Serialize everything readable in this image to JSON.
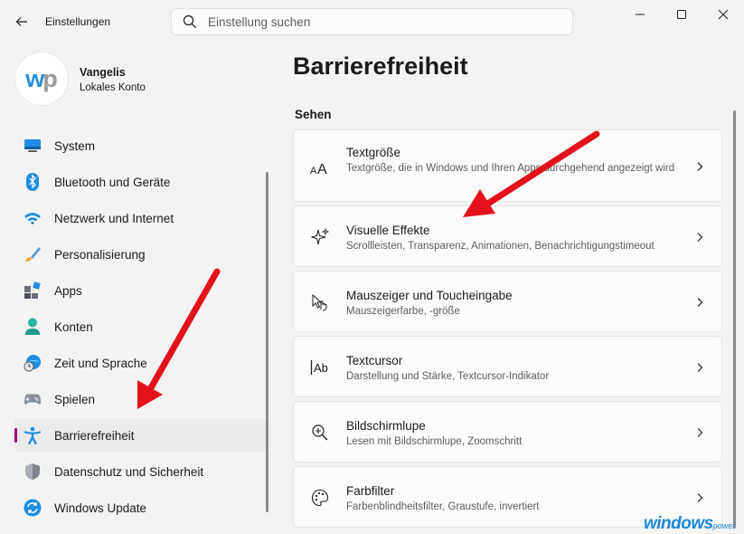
{
  "window": {
    "app_title": "Einstellungen",
    "search_placeholder": "Einstellung suchen"
  },
  "profile": {
    "avatar_text_1": "w",
    "avatar_text_2": "p",
    "name": "Vangelis",
    "account_type": "Lokales Konto"
  },
  "sidebar": {
    "items": [
      {
        "label": "System",
        "icon": "system-icon"
      },
      {
        "label": "Bluetooth und Geräte",
        "icon": "bluetooth-icon"
      },
      {
        "label": "Netzwerk und Internet",
        "icon": "wifi-icon"
      },
      {
        "label": "Personalisierung",
        "icon": "brush-icon"
      },
      {
        "label": "Apps",
        "icon": "apps-icon"
      },
      {
        "label": "Konten",
        "icon": "account-icon"
      },
      {
        "label": "Zeit und Sprache",
        "icon": "clock-globe-icon"
      },
      {
        "label": "Spielen",
        "icon": "gamepad-icon"
      },
      {
        "label": "Barrierefreiheit",
        "icon": "accessibility-icon",
        "active": true
      },
      {
        "label": "Datenschutz und Sicherheit",
        "icon": "shield-icon"
      },
      {
        "label": "Windows Update",
        "icon": "update-icon"
      }
    ]
  },
  "main": {
    "title": "Barrierefreiheit",
    "section": "Sehen",
    "cards": [
      {
        "title": "Textgröße",
        "description": "Textgröße, die in Windows und Ihren Apps durchgehend angezeigt wird",
        "icon": "text-size-icon"
      },
      {
        "title": "Visuelle Effekte",
        "description": "Scrollleisten, Transparenz, Animationen, Benachrichtigungstimeout",
        "icon": "sparkle-icon"
      },
      {
        "title": "Mauszeiger und Toucheingabe",
        "description": "Mauszeigerfarbe, -größe",
        "icon": "pointer-touch-icon"
      },
      {
        "title": "Textcursor",
        "description": "Darstellung und Stärke, Textcursor-Indikator",
        "icon": "text-cursor-icon"
      },
      {
        "title": "Bildschirmlupe",
        "description": "Lesen mit Bildschirmlupe, Zoomschritt",
        "icon": "magnifier-icon"
      },
      {
        "title": "Farbfilter",
        "description": "Farbenblindheitsfilter, Graustufe, invertiert",
        "icon": "palette-icon"
      }
    ]
  },
  "watermark": {
    "main": "windows",
    "suffix": "power"
  },
  "colors": {
    "accent": "#a2006d",
    "annotation_arrow": "#e3121b",
    "watermark": "#1a86d6"
  }
}
